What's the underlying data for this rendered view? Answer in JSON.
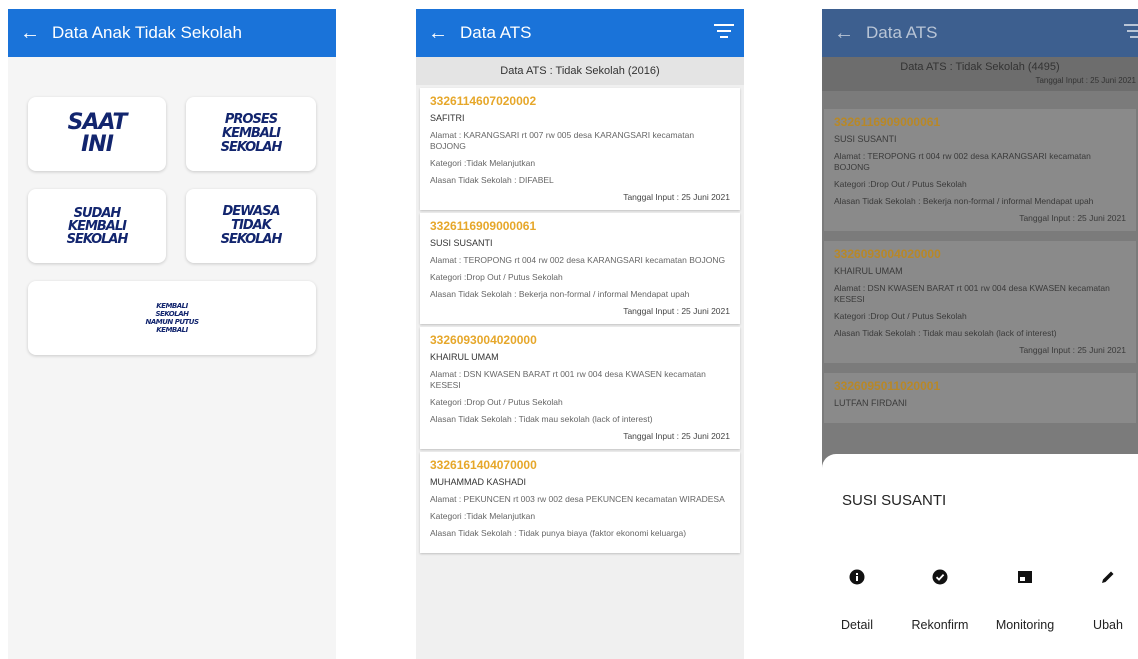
{
  "screen1": {
    "title": "Data Anak Tidak Sekolah",
    "tiles": [
      {
        "label": "SAAT\nINI"
      },
      {
        "label": "PROSES\nKEMBALI\nSEKOLAH"
      },
      {
        "label": "SUDAH\nKEMBALI\nSEKOLAH"
      },
      {
        "label": "DEWASA\nTIDAK\nSEKOLAH"
      },
      {
        "label": "KEMBALI\nSEKOLAH\nNAMUN PUTUS\nKEMBALI"
      }
    ]
  },
  "screen2": {
    "title": "Data ATS",
    "subheader": "Data ATS : Tidak Sekolah (2016)",
    "records": [
      {
        "nik": "3326114607020002",
        "name": "SAFITRI",
        "alamat": "Alamat : KARANGSARI rt 007 rw 005 desa KARANGSARI kecamatan BOJONG",
        "kategori": "Kategori :Tidak Melanjutkan",
        "alasan": "Alasan Tidak Sekolah : DIFABEL",
        "tanggal": "Tanggal Input : 25 Juni 2021"
      },
      {
        "nik": "3326116909000061",
        "name": "SUSI SUSANTI",
        "alamat": "Alamat : TEROPONG rt 004 rw 002 desa KARANGSARI kecamatan BOJONG",
        "kategori": "Kategori :Drop Out / Putus Sekolah",
        "alasan": "Alasan Tidak Sekolah : Bekerja non-formal / informal Mendapat upah",
        "tanggal": "Tanggal Input : 25 Juni 2021"
      },
      {
        "nik": "3326093004020000",
        "name": "KHAIRUL UMAM",
        "alamat": "Alamat : DSN KWASEN BARAT rt 001 rw 004 desa KWASEN kecamatan KESESI",
        "kategori": "Kategori :Drop Out / Putus Sekolah",
        "alasan": "Alasan Tidak Sekolah : Tidak mau sekolah (lack of interest)",
        "tanggal": "Tanggal Input : 25 Juni 2021"
      },
      {
        "nik": "3326161404070000",
        "name": "MUHAMMAD KASHADI",
        "alamat": "Alamat : PEKUNCEN rt 003 rw 002 desa PEKUNCEN kecamatan WIRADESA",
        "kategori": "Kategori :Tidak Melanjutkan",
        "alasan": "Alasan Tidak Sekolah : Tidak punya biaya (faktor ekonomi keluarga)",
        "tanggal": ""
      }
    ]
  },
  "screen3": {
    "title": "Data ATS",
    "subheader": "Data ATS : Tidak Sekolah (4495)",
    "subheader_date": "Tanggal Input : 25 Juni 2021",
    "records": [
      {
        "nik": "3326116909000061",
        "name": "SUSI SUSANTI",
        "alamat": "Alamat : TEROPONG rt 004 rw 002 desa KARANGSARI kecamatan BOJONG",
        "kategori": "Kategori :Drop Out / Putus Sekolah",
        "alasan": "Alasan Tidak Sekolah : Bekerja non-formal / informal Mendapat upah",
        "tanggal": "Tanggal Input : 25 Juni 2021"
      },
      {
        "nik": "3326093004020000",
        "name": "KHAIRUL UMAM",
        "alamat": "Alamat : DSN KWASEN BARAT rt 001 rw 004 desa KWASEN kecamatan KESESI",
        "kategori": "Kategori :Drop Out / Putus Sekolah",
        "alasan": "Alasan Tidak Sekolah : Tidak mau sekolah (lack of interest)",
        "tanggal": "Tanggal Input : 25 Juni 2021"
      },
      {
        "nik": "3326095011020001",
        "name": "LUTFAN FIRDANI",
        "alamat": "",
        "kategori": "",
        "alasan": "",
        "tanggal": ""
      }
    ],
    "sheet": {
      "name": "SUSI SUSANTI",
      "actions": [
        {
          "label": "Detail",
          "icon": "info-icon"
        },
        {
          "label": "Rekonfirm",
          "icon": "check-circle-icon"
        },
        {
          "label": "Monitoring",
          "icon": "dashboard-icon"
        },
        {
          "label": "Ubah",
          "icon": "pencil-icon"
        }
      ]
    }
  },
  "colors": {
    "appbar": "#1a73d9",
    "nik": "#e6a72a",
    "tile_text": "#12256e"
  }
}
